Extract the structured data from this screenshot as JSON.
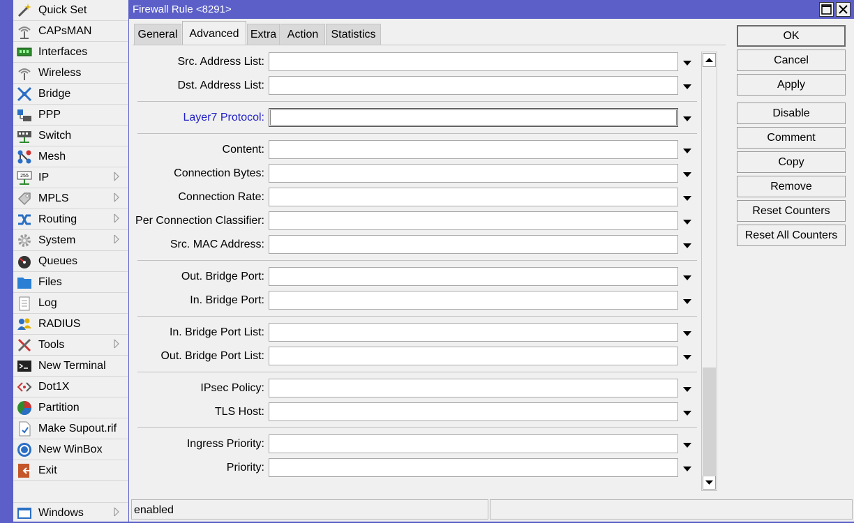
{
  "menu": [
    {
      "label": "Quick Set",
      "icon": "magic-wand-icon",
      "submenu": false
    },
    {
      "label": "CAPsMAN",
      "icon": "antenna-icon",
      "submenu": false
    },
    {
      "label": "Interfaces",
      "icon": "network-card-icon",
      "submenu": false
    },
    {
      "label": "Wireless",
      "icon": "wireless-icon",
      "submenu": false
    },
    {
      "label": "Bridge",
      "icon": "bridge-icon",
      "submenu": false
    },
    {
      "label": "PPP",
      "icon": "ppp-icon",
      "submenu": false
    },
    {
      "label": "Switch",
      "icon": "switch-icon",
      "submenu": false
    },
    {
      "label": "Mesh",
      "icon": "mesh-icon",
      "submenu": false
    },
    {
      "label": "IP",
      "icon": "ip-icon",
      "icon_text": "255",
      "submenu": true
    },
    {
      "label": "MPLS",
      "icon": "mpls-icon",
      "submenu": true
    },
    {
      "label": "Routing",
      "icon": "routing-icon",
      "submenu": true
    },
    {
      "label": "System",
      "icon": "gear-icon",
      "submenu": true
    },
    {
      "label": "Queues",
      "icon": "gauge-icon",
      "submenu": false
    },
    {
      "label": "Files",
      "icon": "folder-icon",
      "submenu": false
    },
    {
      "label": "Log",
      "icon": "notepad-icon",
      "submenu": false
    },
    {
      "label": "RADIUS",
      "icon": "users-icon",
      "submenu": false
    },
    {
      "label": "Tools",
      "icon": "tools-icon",
      "submenu": true
    },
    {
      "label": "New Terminal",
      "icon": "terminal-icon",
      "submenu": false
    },
    {
      "label": "Dot1X",
      "icon": "dot1x-icon",
      "submenu": false
    },
    {
      "label": "Partition",
      "icon": "pie-chart-icon",
      "submenu": false
    },
    {
      "label": "Make Supout.rif",
      "icon": "document-icon",
      "submenu": false
    },
    {
      "label": "New WinBox",
      "icon": "winbox-icon",
      "submenu": false
    },
    {
      "label": "Exit",
      "icon": "exit-icon",
      "submenu": false
    },
    {
      "label": "Windows",
      "icon": "window-icon",
      "submenu": true
    }
  ],
  "window": {
    "title": "Firewall Rule <8291>",
    "maximize_icon": "maximize-icon",
    "close_icon": "close-icon"
  },
  "tabs": [
    {
      "label": "General",
      "active": false
    },
    {
      "label": "Advanced",
      "active": true
    },
    {
      "label": "Extra",
      "active": false
    },
    {
      "label": "Action",
      "active": false
    },
    {
      "label": "Statistics",
      "active": false
    }
  ],
  "fields": [
    {
      "label": "Src. Address List:",
      "value": ""
    },
    {
      "label": "Dst. Address List:",
      "value": ""
    },
    {
      "label": "Layer7 Protocol:",
      "value": "",
      "link": true,
      "focused": true
    },
    {
      "label": "Content:",
      "value": ""
    },
    {
      "label": "Connection Bytes:",
      "value": ""
    },
    {
      "label": "Connection Rate:",
      "value": ""
    },
    {
      "label": "Per Connection Classifier:",
      "value": ""
    },
    {
      "label": "Src. MAC Address:",
      "value": ""
    },
    {
      "label": "Out. Bridge Port:",
      "value": ""
    },
    {
      "label": "In. Bridge Port:",
      "value": ""
    },
    {
      "label": "In. Bridge Port List:",
      "value": ""
    },
    {
      "label": "Out. Bridge Port List:",
      "value": ""
    },
    {
      "label": "IPsec Policy:",
      "value": ""
    },
    {
      "label": "TLS Host:",
      "value": ""
    },
    {
      "label": "Ingress Priority:",
      "value": ""
    },
    {
      "label": "Priority:",
      "value": ""
    }
  ],
  "buttons": [
    {
      "label": "OK",
      "default": true
    },
    {
      "label": "Cancel"
    },
    {
      "label": "Apply"
    },
    {
      "label": "Disable"
    },
    {
      "label": "Comment"
    },
    {
      "label": "Copy"
    },
    {
      "label": "Remove"
    },
    {
      "label": "Reset Counters"
    },
    {
      "label": "Reset All Counters"
    }
  ],
  "status": {
    "left": "enabled",
    "right": ""
  },
  "colors": {
    "title_bar": "#5b5fc7",
    "link_label": "#2222c8",
    "panel": "#f0f0f0"
  }
}
